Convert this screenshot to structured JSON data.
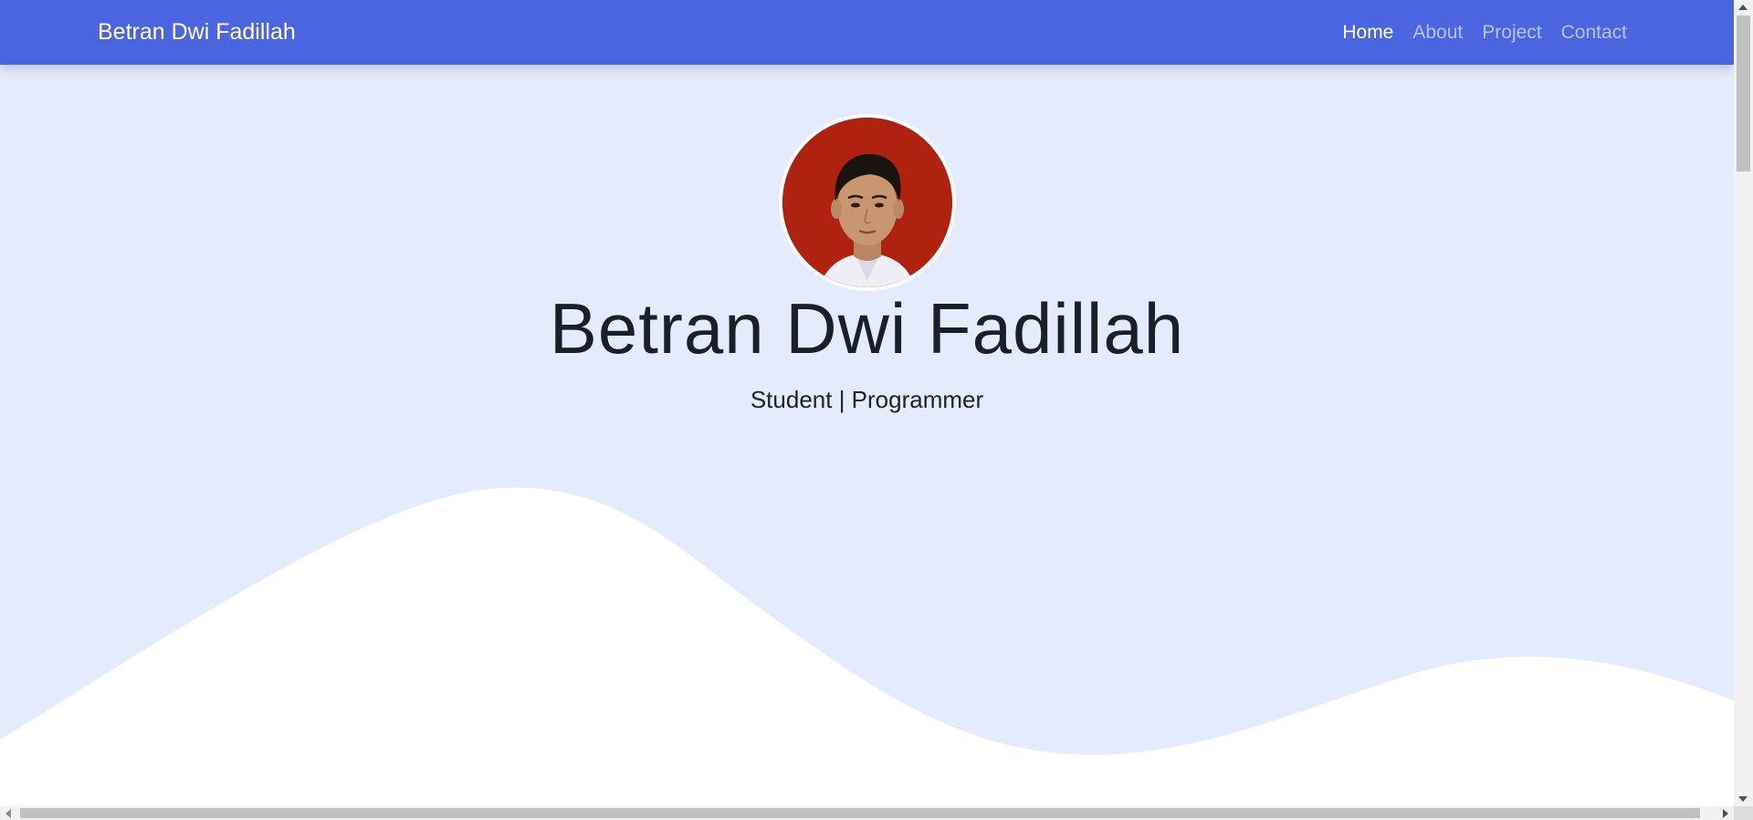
{
  "navbar": {
    "brand": "Betran Dwi Fadillah",
    "links": [
      {
        "label": "Home",
        "active": true
      },
      {
        "label": "About",
        "active": false
      },
      {
        "label": "Project",
        "active": false
      },
      {
        "label": "Contact",
        "active": false
      }
    ]
  },
  "hero": {
    "name": "Betran Dwi Fadillah",
    "subtitle": "Student | Programmer"
  },
  "colors": {
    "navbar": "#4a65df",
    "hero_background": "#e3ebfd",
    "wave": "#ffffff",
    "avatar_background": "#b02210"
  }
}
